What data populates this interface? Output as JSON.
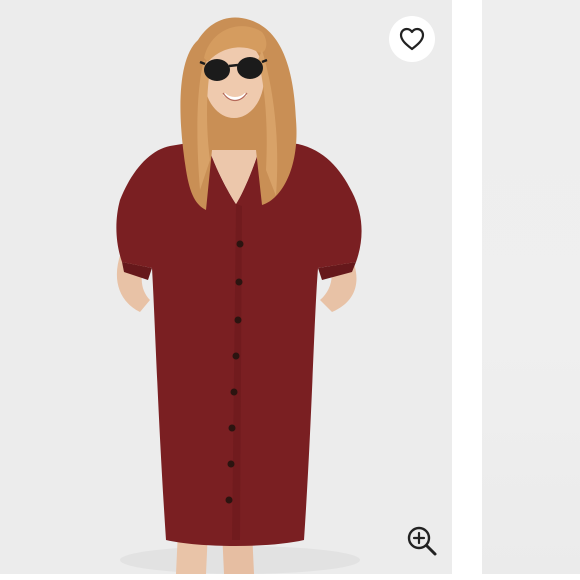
{
  "gallery": {
    "current_slide": 1,
    "slides_visible": 2
  },
  "icons": {
    "like": "heart-outline-icon",
    "zoom": "zoom-in-icon"
  },
  "colors": {
    "background": "#ececec",
    "dress": "#7a1f22",
    "icon": "#222222",
    "button_bg": "#ffffff"
  }
}
